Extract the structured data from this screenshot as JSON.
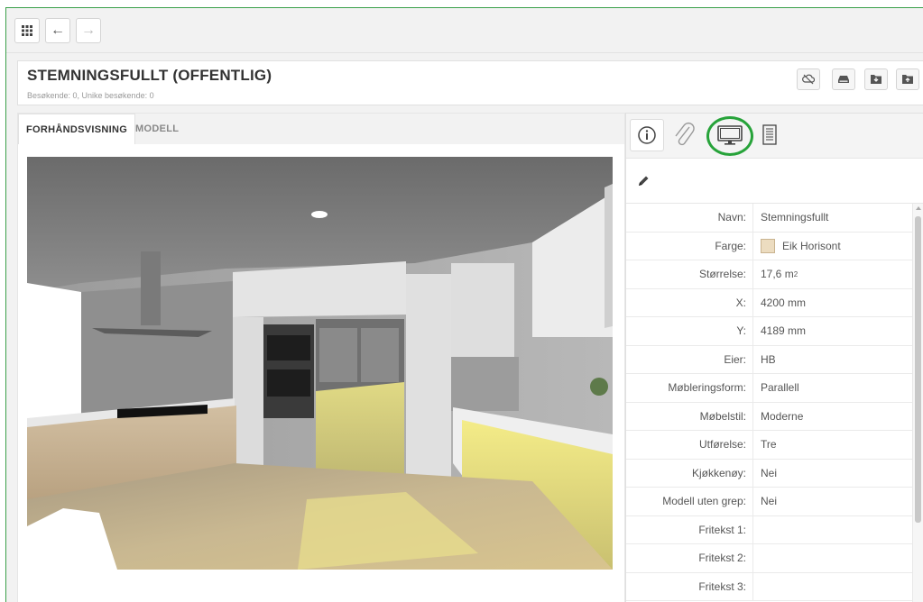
{
  "toolbar": {
    "apps_icon": "grid-icon",
    "back_icon": "←",
    "forward_icon": "→"
  },
  "header": {
    "title": "STEMNINGSFULLT (OFFENTLIG)",
    "subtitle": "Besøkende: 0, Unike besøkende: 0",
    "actions": [
      "cloud-off-icon",
      "hard-drive-icon",
      "download-folder-icon",
      "upload-folder-icon"
    ]
  },
  "preview": {
    "tabs": [
      {
        "label": "FORHÅNDSVISNING",
        "active": true
      },
      {
        "label": "MODELL",
        "active": false
      }
    ]
  },
  "panel": {
    "tabs": [
      "info-icon",
      "paperclip-icon",
      "monitor-icon",
      "document-icon"
    ],
    "properties": [
      {
        "label": "Navn:",
        "value": "Stemningsfullt"
      },
      {
        "label": "Farge:",
        "value": "Eik Horisont",
        "swatch": "#ecdcc0"
      },
      {
        "label": "Størrelse:",
        "value": "17,6 m",
        "sup": "2"
      },
      {
        "label": "X:",
        "value": "4200 mm"
      },
      {
        "label": "Y:",
        "value": "4189 mm"
      },
      {
        "label": "Eier:",
        "value": "HB"
      },
      {
        "label": "Møbleringsform:",
        "value": "Parallell"
      },
      {
        "label": "Møbelstil:",
        "value": "Moderne"
      },
      {
        "label": "Utførelse:",
        "value": "Tre"
      },
      {
        "label": "Kjøkkenøy:",
        "value": "Nei"
      },
      {
        "label": "Modell uten grep:",
        "value": "Nei"
      },
      {
        "label": "Fritekst 1:",
        "value": ""
      },
      {
        "label": "Fritekst 2:",
        "value": ""
      },
      {
        "label": "Fritekst 3:",
        "value": ""
      }
    ]
  },
  "colors": {
    "highlight": "#27a33a",
    "frame_border": "#3aa04a"
  }
}
